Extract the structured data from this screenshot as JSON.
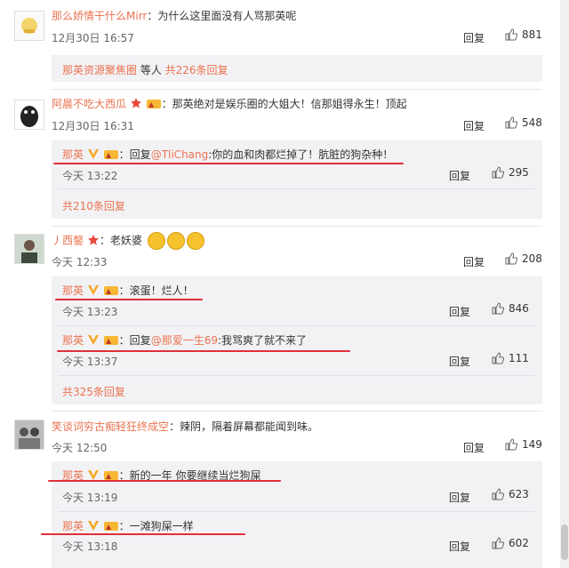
{
  "comments": [
    {
      "user": "那么娇情干什么Mirr",
      "text": "：为什么这里面没有人骂那英呢",
      "time": "12月30日 16:57",
      "reply_label": "回复",
      "likes": "881",
      "more": "那英资源聚焦圈",
      "more_suffix": " 等人 ",
      "more_count": "共226条回复"
    },
    {
      "user": "阿晨不吃大西瓜",
      "text": "：那英绝对是娱乐圈的大姐大！信那姐得永生！顶起",
      "time": "12月30日 16:31",
      "reply_label": "回复",
      "likes": "548",
      "sub": [
        {
          "user": "那英",
          "prefix": "：回复",
          "mention": "@TliChang",
          "text": ":你的血和肉都烂掉了！肮脏的狗杂种！",
          "time": "今天 13:22",
          "reply_label": "回复",
          "likes": "295"
        }
      ],
      "more_count": "共210条回复"
    },
    {
      "user": "丿西鍪",
      "text": "：老妖婆",
      "time": "今天 12:33",
      "reply_label": "回复",
      "likes": "208",
      "sub": [
        {
          "user": "那英",
          "prefix": "",
          "mention": "",
          "text": "：滚蛋！烂人！",
          "time": "今天 13:23",
          "reply_label": "回复",
          "likes": "846"
        },
        {
          "user": "那英",
          "prefix": "：回复",
          "mention": "@那爱一生69",
          "text": ":我骂爽了就不来了",
          "time": "今天 13:37",
          "reply_label": "回复",
          "likes": "111"
        }
      ],
      "more_count": "共325条回复"
    },
    {
      "user": "笑谈词穷古痴轻狂终成空",
      "text": "：辣阴，隔着屏幕都能闻到味。",
      "time": "今天 12:50",
      "reply_label": "回复",
      "likes": "149",
      "sub": [
        {
          "user": "那英",
          "prefix": "",
          "mention": "",
          "text": "：新的一年 你要继续当烂狗屎",
          "time": "今天 13:19",
          "reply_label": "回复",
          "likes": "623"
        },
        {
          "user": "那英",
          "prefix": "",
          "mention": "",
          "text": "：一滩狗屎一样",
          "time": "今天 13:18",
          "reply_label": "回复",
          "likes": "602"
        }
      ]
    }
  ],
  "colors": {
    "name": "#eb7350",
    "underline": "#e0303a",
    "box": "#f2f2f5"
  },
  "icons": {
    "like": "thumbs-up-icon",
    "vip": "v-badge-icon",
    "star": "star-badge-icon"
  }
}
